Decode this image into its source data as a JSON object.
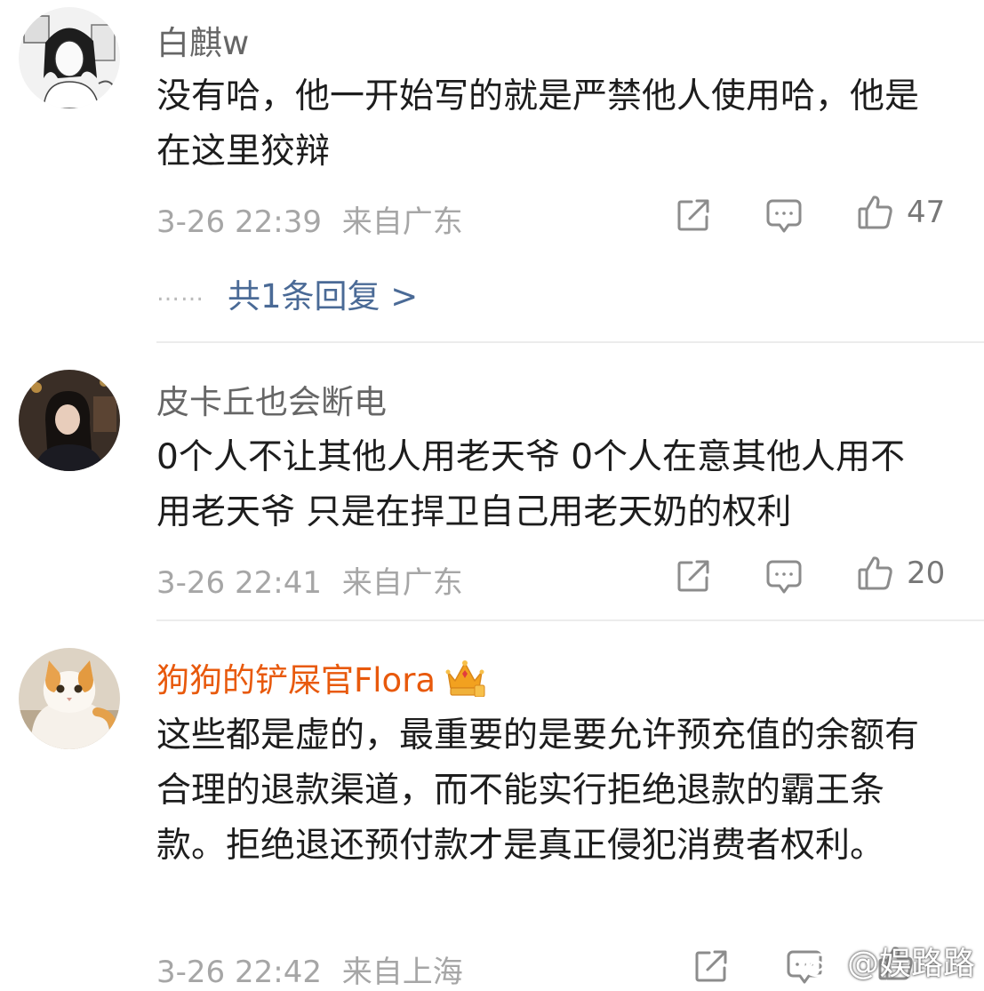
{
  "comments": [
    {
      "username": "白麒w",
      "text": "没有哈，他一开始写的就是严禁他人使用哈，他是在这里狡辩",
      "time": "3-26 22:39",
      "location": "来自广东",
      "likes": "47",
      "reply_dots": "……",
      "reply_link": "共1条回复 >"
    },
    {
      "username": "皮卡丘也会断电",
      "text": "0个人不让其他人用老天爷 0个人在意其他人用不用老天爷 只是在捍卫自己用老天奶的权利",
      "time": "3-26 22:41",
      "location": "来自广东",
      "likes": "20"
    },
    {
      "username": "狗狗的铲屎官Flora",
      "badge_icon": "vip-crown-icon",
      "text": "这些都是虚的，最重要的是要允许预充值的余额有合理的退款渠道，而不能实行拒绝退款的霸王条款。拒绝退还预付款才是真正侵犯消费者权利。",
      "time": "3-26 22:42",
      "location": "来自上海"
    }
  ],
  "icons": {
    "share": "share-icon",
    "comment": "comment-icon",
    "like": "thumbs-up-icon"
  },
  "watermark": {
    "text": "@娱路路"
  },
  "colors": {
    "vip_name": "#e8590c",
    "link": "#4a6a96",
    "meta": "#a6a6a6"
  }
}
